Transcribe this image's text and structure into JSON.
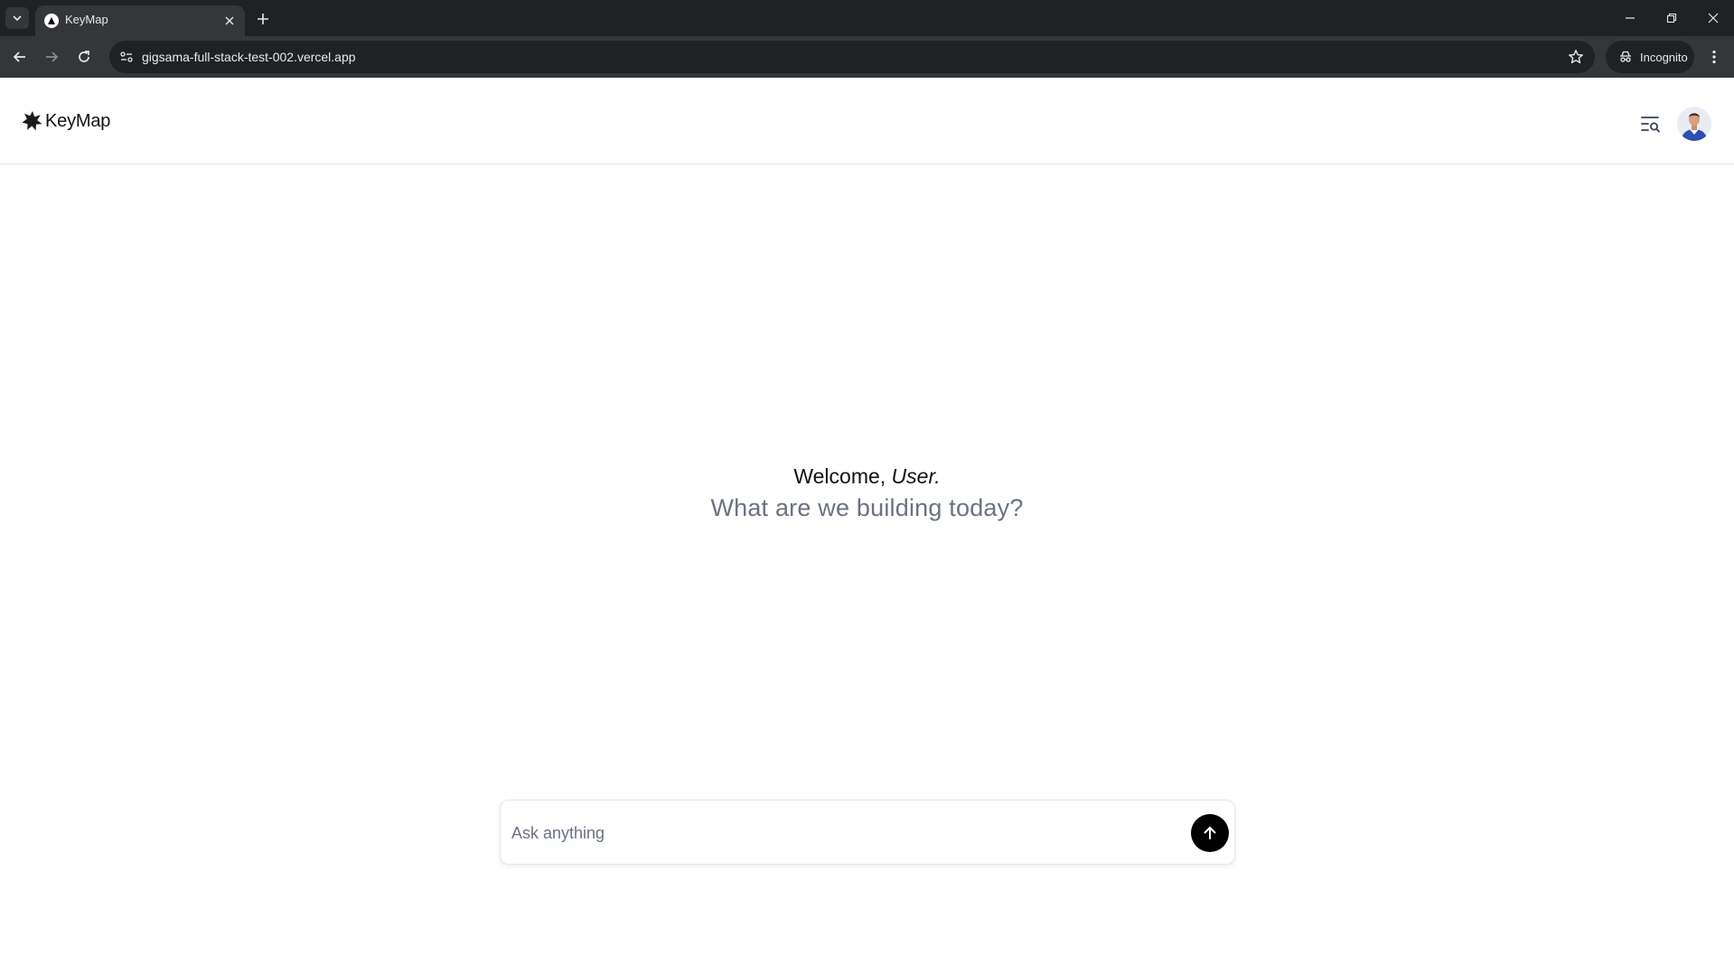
{
  "browser": {
    "tab_title": "KeyMap",
    "url": "gigsama-full-stack-test-002.vercel.app",
    "incognito_label": "Incognito"
  },
  "app": {
    "logo_text": "KeyMap"
  },
  "welcome": {
    "greeting": "Welcome,",
    "user_name": "User.",
    "subtitle": "What are we building today?"
  },
  "composer": {
    "placeholder": "Ask anything",
    "value": ""
  },
  "colors": {
    "accent": "#000000",
    "muted_text": "#6b7280",
    "chrome_dark": "#202124",
    "chrome_toolbar": "#35363a"
  }
}
